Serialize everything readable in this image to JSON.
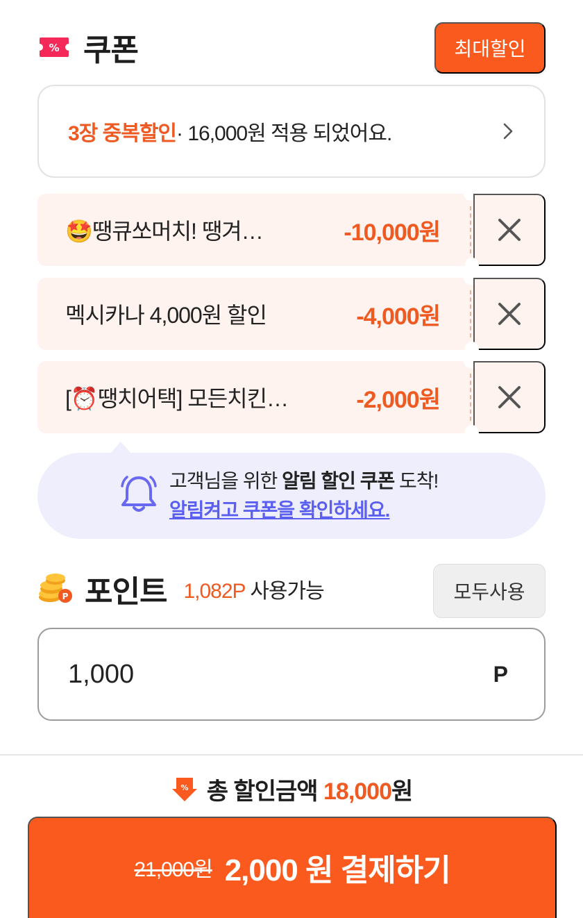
{
  "coupon": {
    "title": "쿠폰",
    "ticket_symbol": "%",
    "max_discount_label": "최대할인",
    "applied": {
      "highlight": "3장 중복할인",
      "text": "· 16,000원 적용 되었어요."
    },
    "items": [
      {
        "name": "🤩땡큐쏘머치! 땡겨…",
        "amount": "-10,000원"
      },
      {
        "name": "멕시카나 4,000원 할인",
        "amount": "-4,000원"
      },
      {
        "name": "[⏰땡치어택] 모든치킨…",
        "amount": "-2,000원"
      }
    ]
  },
  "notice": {
    "line1_prefix": "고객님을 위한 ",
    "line1_bold": "알림 할인 쿠폰",
    "line1_suffix": " 도착!",
    "link": "알림켜고 쿠폰을 확인하세요."
  },
  "point": {
    "title": "포인트",
    "available_amount": "1,082P",
    "available_label": " 사용가능",
    "use_all_label": "모두사용",
    "input_value": "1,000",
    "unit": "P"
  },
  "summary": {
    "label": "총 할인금액 ",
    "amount": "18,000",
    "currency": "원"
  },
  "pay": {
    "original_price": "21,000원",
    "label": "2,000 원 결제하기"
  },
  "colors": {
    "accent": "#fb5a1e",
    "accent_text": "#ee5a22",
    "coupon_bg": "#fff3ef",
    "notice_bg": "#eeeefd",
    "link": "#5b5ff0"
  }
}
